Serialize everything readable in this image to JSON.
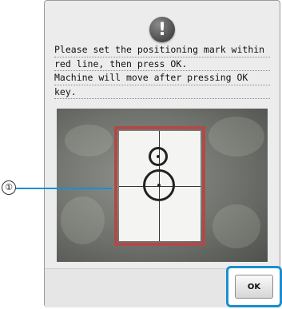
{
  "dialog": {
    "icon": "exclamation-icon",
    "icon_glyph": "!",
    "message_lines": [
      "Please set the positioning mark within",
      "red line, then press OK.",
      "Machine will move after pressing OK",
      "key."
    ],
    "ok_label": "OK"
  },
  "callout": {
    "label": "①"
  },
  "colors": {
    "frame": "#b04a48",
    "highlight": "#1a8fd0"
  }
}
